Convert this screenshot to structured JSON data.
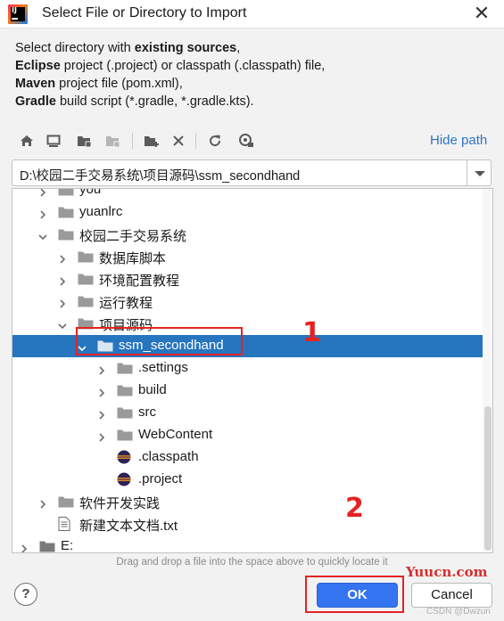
{
  "window": {
    "title": "Select File or Directory to Import"
  },
  "description": {
    "lines": [
      {
        "bold": "",
        "text": "Select directory with ",
        "bold2": "existing sources",
        "tail": ","
      },
      {
        "bold": "Eclipse",
        "text": " project (.project) or classpath (.classpath) file,",
        "bold2": "",
        "tail": ""
      },
      {
        "bold": "Maven",
        "text": " project file (pom.xml),",
        "bold2": "",
        "tail": ""
      },
      {
        "bold": "Gradle",
        "text": " build script (*.gradle, *.gradle.kts).",
        "bold2": "",
        "tail": ""
      }
    ]
  },
  "toolbar": {
    "icons": [
      "home-icon",
      "desktop-icon",
      "project-folder-icon",
      "module-folder-icon",
      "new-folder-icon",
      "delete-icon",
      "refresh-icon",
      "show-hidden-icon"
    ],
    "hide_path_label": "Hide path"
  },
  "path_field": {
    "value": "D:\\校园二手交易系统\\项目源码\\ssm_secondhand"
  },
  "tree": {
    "rows": [
      {
        "label": "you",
        "kind": "folder",
        "depth": 1,
        "state": "collapsed"
      },
      {
        "label": "yuanlrc",
        "kind": "folder",
        "depth": 1,
        "state": "collapsed"
      },
      {
        "label": "校园二手交易系统",
        "kind": "folder",
        "depth": 1,
        "state": "expanded"
      },
      {
        "label": "数据库脚本",
        "kind": "folder",
        "depth": 2,
        "state": "collapsed"
      },
      {
        "label": "环境配置教程",
        "kind": "folder",
        "depth": 2,
        "state": "collapsed"
      },
      {
        "label": "运行教程",
        "kind": "folder",
        "depth": 2,
        "state": "collapsed"
      },
      {
        "label": "项目源码",
        "kind": "folder",
        "depth": 2,
        "state": "expanded"
      },
      {
        "label": "ssm_secondhand",
        "kind": "folder",
        "depth": 3,
        "state": "expanded",
        "selected": true
      },
      {
        "label": ".settings",
        "kind": "folder",
        "depth": 4,
        "state": "collapsed"
      },
      {
        "label": "build",
        "kind": "folder",
        "depth": 4,
        "state": "collapsed"
      },
      {
        "label": "src",
        "kind": "folder",
        "depth": 4,
        "state": "collapsed"
      },
      {
        "label": "WebContent",
        "kind": "folder",
        "depth": 4,
        "state": "collapsed"
      },
      {
        "label": ".classpath",
        "kind": "eclipse",
        "depth": 4,
        "state": "leaf"
      },
      {
        "label": ".project",
        "kind": "eclipse",
        "depth": 4,
        "state": "leaf"
      },
      {
        "label": "软件开发实践",
        "kind": "folder",
        "depth": 1,
        "state": "collapsed"
      },
      {
        "label": "新建文本文档.txt",
        "kind": "file",
        "depth": 1,
        "state": "leaf"
      },
      {
        "label": "E:",
        "kind": "drive",
        "depth": 0,
        "state": "collapsed"
      }
    ]
  },
  "hint": "Drag and drop a file into the space above to quickly locate it",
  "annotations": {
    "step1": "1",
    "step2": "2"
  },
  "buttons": {
    "help": "?",
    "ok": "OK",
    "cancel": "Cancel"
  },
  "watermark": {
    "site": "Yuucn.com",
    "user": "CSDN @Dwzun"
  },
  "colors": {
    "selection": "#2675bf",
    "link": "#2e73c6",
    "ok_button": "#3574f0",
    "annotation_red": "#e52222"
  }
}
